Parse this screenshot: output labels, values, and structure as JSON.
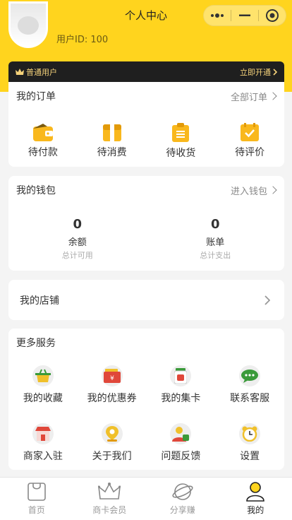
{
  "header": {
    "title": "个人中心",
    "user_id": "用户ID: 100"
  },
  "member": {
    "level": "普通用户",
    "action": "立即开通"
  },
  "orders": {
    "title": "我的订单",
    "more": "全部订单",
    "items": [
      {
        "label": "待付款",
        "icon": "wallet-icon"
      },
      {
        "label": "待消费",
        "icon": "gift-box-icon"
      },
      {
        "label": "待收货",
        "icon": "clipboard-icon"
      },
      {
        "label": "待评价",
        "icon": "checkbox-icon"
      }
    ]
  },
  "wallet": {
    "title": "我的钱包",
    "more": "进入钱包",
    "items": [
      {
        "value": "0",
        "label": "余额",
        "sub": "总计可用"
      },
      {
        "value": "0",
        "label": "账单",
        "sub": "总计支出"
      }
    ]
  },
  "store": {
    "label": "我的店铺"
  },
  "services": {
    "title": "更多服务",
    "items": [
      {
        "label": "我的收藏",
        "icon": "basket-icon"
      },
      {
        "label": "我的优惠券",
        "icon": "coupon-icon"
      },
      {
        "label": "我的集卡",
        "icon": "jar-icon"
      },
      {
        "label": "联系客服",
        "icon": "chat-icon"
      },
      {
        "label": "商家入驻",
        "icon": "shop-icon"
      },
      {
        "label": "关于我们",
        "icon": "location-icon"
      },
      {
        "label": "问题反馈",
        "icon": "user-feedback-icon"
      },
      {
        "label": "设置",
        "icon": "alarm-clock-icon"
      }
    ]
  },
  "tabbar": {
    "items": [
      {
        "label": "首页",
        "icon": "bag-icon"
      },
      {
        "label": "商卡会员",
        "icon": "crown-icon"
      },
      {
        "label": "分享赚",
        "icon": "planet-icon"
      },
      {
        "label": "我的",
        "icon": "person-icon"
      }
    ],
    "active": "我的"
  },
  "colors": {
    "accent": "#ffd41e",
    "member_bar": "#1f1f1f",
    "member_text": "#f5d27a",
    "icon_yellow": "#f9b81d"
  }
}
